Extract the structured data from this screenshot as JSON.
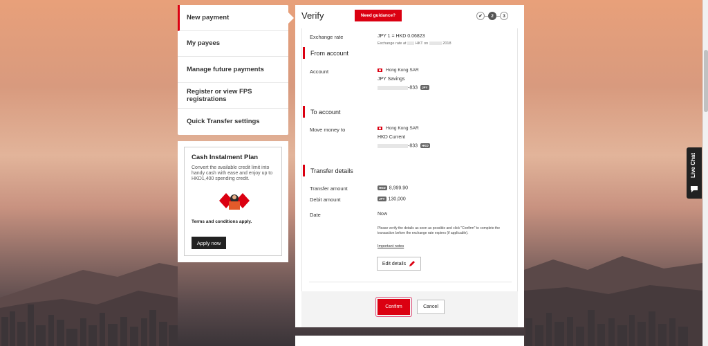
{
  "nav": {
    "items": [
      {
        "label": "New payment",
        "active": true
      },
      {
        "label": "My payees"
      },
      {
        "label": "Manage future payments"
      },
      {
        "label": "Register or view FPS registrations"
      },
      {
        "label": "Quick Transfer settings"
      }
    ]
  },
  "promo": {
    "title": "Cash Instalment Plan",
    "text": "Convert the available credit limit into handy cash with ease and enjoy up to HKD1,400 spending credit.",
    "terms": "Terms and conditions apply.",
    "apply_label": "Apply now"
  },
  "verify": {
    "title": "Verify",
    "guidance_label": "Need guidance?",
    "steps": [
      "✔",
      "2",
      "3"
    ],
    "exchange": {
      "label": "Exchange rate",
      "value": "JPY 1 = HKD 0.06823",
      "sub_prefix": "Exchange rate at",
      "sub_mid": "HKT on",
      "sub_year": "2018"
    },
    "from": {
      "heading": "From account",
      "label": "Account",
      "region": "Hong Kong SAR",
      "name": "JPY Savings",
      "suffix": "-833",
      "currency": "JPY"
    },
    "to": {
      "heading": "To account",
      "label": "Move money to",
      "region": "Hong Kong SAR",
      "name": "HKD Current",
      "suffix": "-833",
      "currency": "HKD"
    },
    "details": {
      "heading": "Transfer details",
      "transfer_label": "Transfer amount",
      "transfer_ccy": "HKD",
      "transfer_value": "8,999.90",
      "debit_label": "Debit amount",
      "debit_ccy": "JPY",
      "debit_value": "130,000",
      "date_label": "Date",
      "date_value": "Now",
      "note": "Please verify the details as soon as possible and click \"Confirm\" to complete the transaction before the exchange rate expires (if applicable).",
      "important_link": "Important notes",
      "edit_label": "Edit details"
    },
    "confirm_label": "Confirm",
    "cancel_label": "Cancel"
  },
  "live_chat": {
    "label": "Live Chat"
  },
  "colors": {
    "accent": "#db0011",
    "dark": "#222222"
  }
}
